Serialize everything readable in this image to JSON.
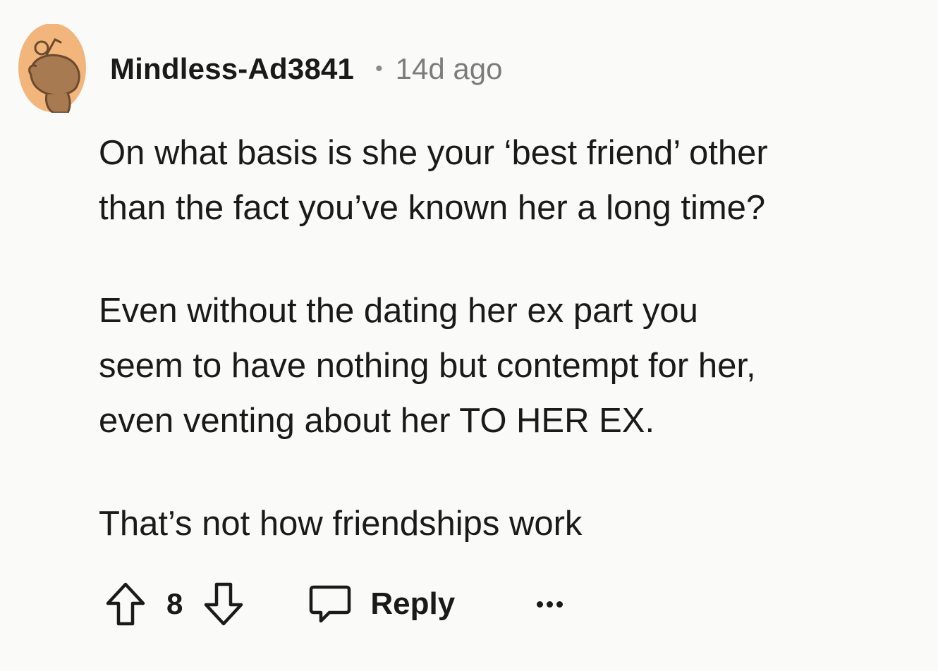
{
  "comment": {
    "username": "Mindless-Ad3841",
    "separator": "•",
    "timestamp": "14d ago",
    "avatar_icon": "snoo-avatar-icon",
    "paragraphs": [
      [
        "On what basis is she your ‘best friend’ other",
        "than the fact you’ve known her a long time?"
      ],
      [
        "Even without the dating her ex part you",
        "seem to have nothing but contempt for her,",
        "even venting about her TO HER EX."
      ],
      [
        "That’s not how friendships work"
      ]
    ]
  },
  "actions": {
    "upvote_icon": "upvote-arrow-icon",
    "score": "8",
    "downvote_icon": "downvote-arrow-icon",
    "reply_icon": "comment-bubble-icon",
    "reply_label": "Reply",
    "more_icon": "more-options-icon"
  },
  "colors": {
    "background": "#fafaf8",
    "text": "#1a1a1b",
    "muted": "#7c7c7c",
    "avatar_bg": "#f2b57c",
    "avatar_fg": "#a87a52"
  }
}
